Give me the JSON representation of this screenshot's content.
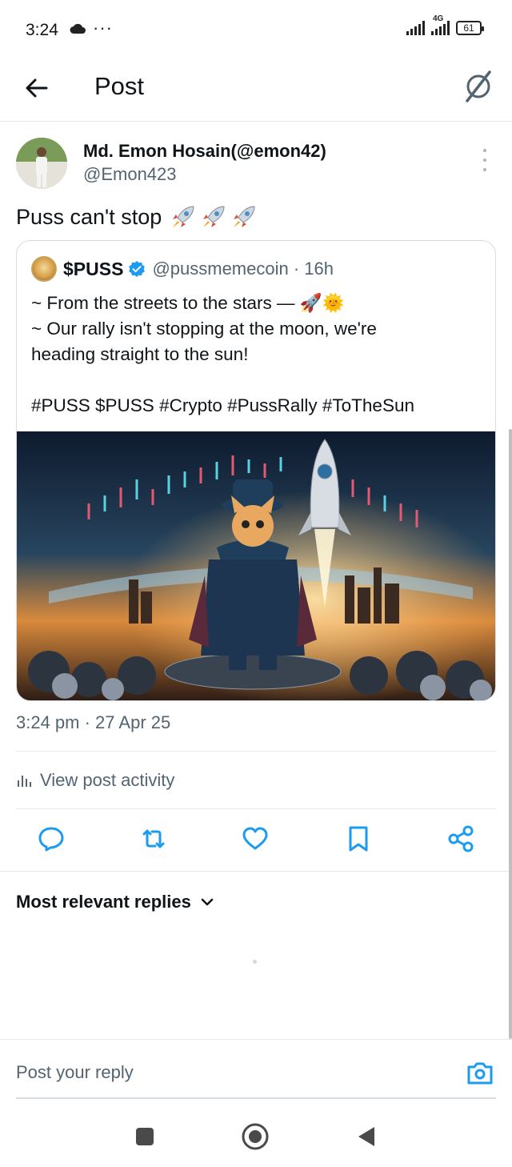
{
  "status_bar": {
    "time": "3:24",
    "dots": "···",
    "network_label": "4G",
    "battery": "61"
  },
  "header": {
    "title": "Post",
    "back_icon": "arrow-left-icon",
    "grok_icon": "grok-icon"
  },
  "post": {
    "author_name": "Md. Emon Hosain(@emon42)",
    "author_handle": "@Emon423",
    "text": "Puss can't stop",
    "emojis": [
      "rocket",
      "rocket",
      "rocket"
    ],
    "timestamp": "3:24 pm · 27 Apr 25",
    "view_activity": "View post activity"
  },
  "quote": {
    "name": "$PUSS",
    "handle": "@pussmemecoin · 16h",
    "lines": [
      "~ From the streets to the stars — 🚀🌞",
      "~ Our rally isn't stopping at the moon, we're",
      "heading straight to the sun!",
      "",
      "#PUSS $PUSS #Crypto #PussRally #ToTheSun"
    ]
  },
  "actions": [
    "reply-icon",
    "repost-icon",
    "like-icon",
    "bookmark-icon",
    "share-icon"
  ],
  "replies": {
    "sort_label": "Most relevant replies"
  },
  "reply_bar": {
    "placeholder": "Post your reply"
  },
  "colors": {
    "accent": "#1d9bf0",
    "muted": "#536471",
    "text": "#0f1419",
    "divider": "#e6e9ec"
  }
}
